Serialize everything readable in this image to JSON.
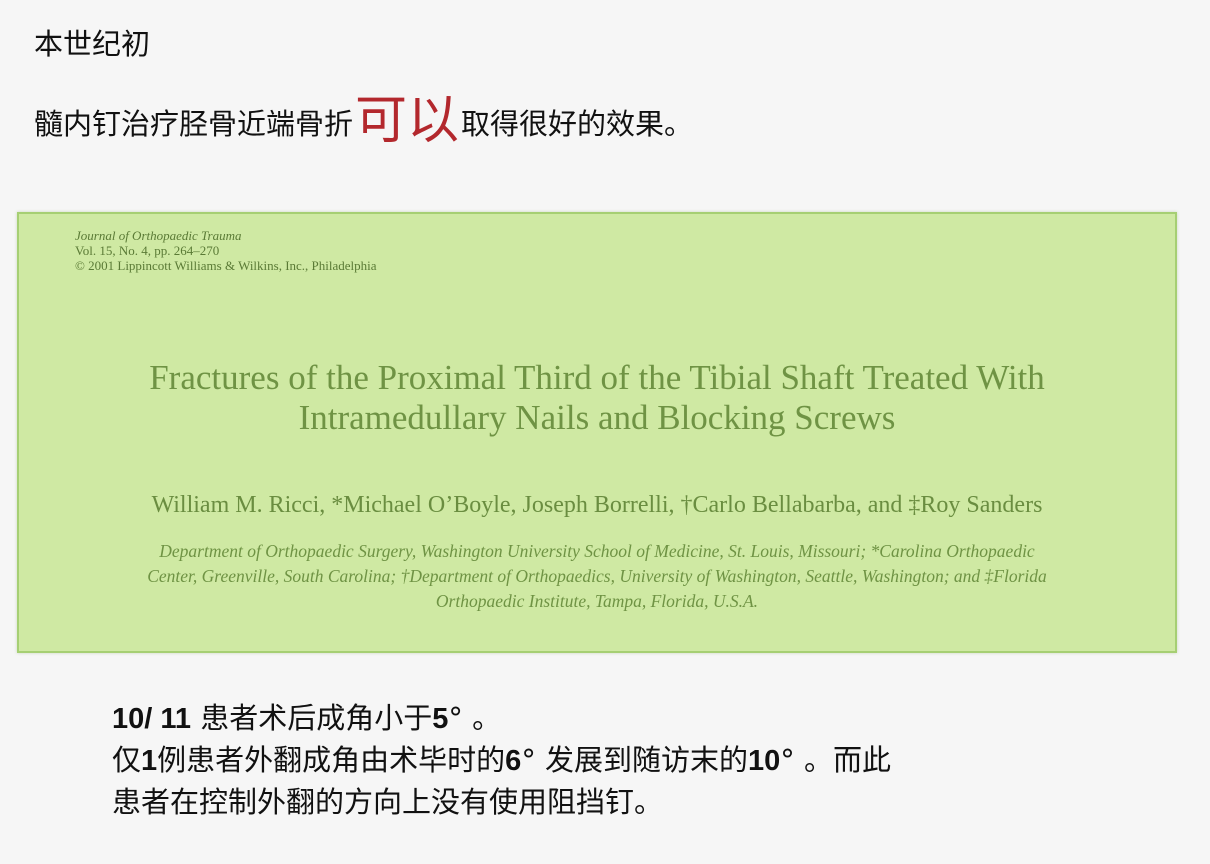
{
  "slide": {
    "heading_small": "本世纪初",
    "heading_before": "髓内钉治疗胫骨近端骨折",
    "heading_emphasis": "可以",
    "heading_after": "取得很好的效果。"
  },
  "article": {
    "journal_name": "Journal of Orthopaedic Trauma",
    "journal_volume": "Vol. 15, No. 4, pp. 264–270",
    "journal_copyright": "© 2001 Lippincott Williams & Wilkins, Inc., Philadelphia",
    "title_line1": "Fractures of the Proximal Third of the Tibial Shaft Treated With",
    "title_line2": "Intramedullary Nails and Blocking Screws",
    "authors": "William M. Ricci, *Michael O’Boyle, Joseph Borrelli, †Carlo Bellabarba, and ‡Roy Sanders",
    "affiliation_line1": "Department of Orthopaedic Surgery, Washington University School of Medicine, St. Louis, Missouri; *Carolina Orthopaedic",
    "affiliation_line2": "Center, Greenville, South Carolina; †Department of Orthopaedics, University of Washington, Seattle, Washington; and ‡Florida",
    "affiliation_line3": "Orthopaedic Institute, Tampa, Florida, U.S.A."
  },
  "findings": {
    "line1_num": "10/ 11",
    "line1_text": " 患者术后成角小于",
    "line1_deg": "5",
    "line1_end": "°  。",
    "line2_a": "仅",
    "line2_num1": "1",
    "line2_b": "例患者外翻成角由术毕时的",
    "line2_num2": "6",
    "line2_c": "°  发展到随访末的",
    "line2_num3": "10",
    "line2_d": "°  。而此",
    "line3": "患者在控制外翻的方向上没有使用阻挡钉。"
  },
  "colors": {
    "emphasis": "#b3282d",
    "box_background": "#cfe9a3",
    "article_text": "#6f9344"
  }
}
